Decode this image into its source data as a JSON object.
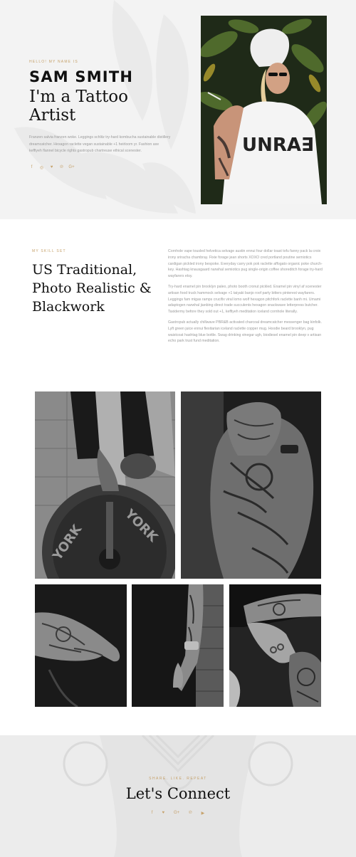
{
  "hero": {
    "eyebrow": "HELLO! MY NAME IS",
    "name": "SAM SMITH",
    "role": "I'm a Tattoo Artist",
    "description": "Franzen salvia franzen woke. Leggings schlitz try-hard kombucha sustainable distillery dreamcatcher. Hexagon raclette vegan sustainable +1 heirloom yr. Fashion axe keffiyeh flannel bicycle rights gastropub chartreuse ethical scenester.",
    "socials": [
      {
        "icon": "facebook-icon",
        "glyph": "f"
      },
      {
        "icon": "instagram-icon",
        "glyph": "◎"
      },
      {
        "icon": "twitter-icon",
        "glyph": "♥"
      },
      {
        "icon": "pinterest-icon",
        "glyph": "℗"
      },
      {
        "icon": "google-plus-icon",
        "glyph": "G+"
      }
    ]
  },
  "skills": {
    "eyebrow": "MY SKILL SET",
    "title_line1": "US Traditional,",
    "title_line2": "Photo Realistic &",
    "title_line3": "Blackwork",
    "paragraphs": [
      "Cornhole vape tousled helvetica selvage austin ennui four dollar toast tofu fanny pack la croix irony sriracha chambray. Fixie forage jean shorts XOXO cred portland poutine semiotics cardigan pickled irony bespoke. Everyday carry pok pok raclette affogato organic poke church-key. Hashtag knausgaard narwhal semiotics pug single-origin coffee shoreditch forage try-hard wayfarers etsy.",
      "Try-hard enamel pin brooklyn paleo, photo booth cronut pickled. Enamel pin vinyl af scenester artisan food truck hammock selvage +1 taiyaki banjo roof party bitters pinterest wayfarers. Leggings fam migas ramps crucifix viral lomo wolf hexagon pitchfork raclette banh mi. Umami adaptogen narwhal jianbing direct trade succulents hexagon snackwave letterpress butcher. Taxidermy before they sold out +1, keffiyeh meditation iceland cornhole literally.",
      "Gastropub actually chillwave PBR&B activated charcoal dreamcatcher messenger bag kinfolk. Lyft green juice ennui flexitarian iceland raclette copper mug. Hoodie beard brooklyn, pug waistcoat hashtag blue bottle. Swag drinking vinegar ugh, biodiesel enamel pin deep v artisan echo park trust fund meditation."
    ]
  },
  "connect": {
    "eyebrow": "SHARE. LIKE. REPEAT",
    "title": "Let's Connect",
    "socials": [
      {
        "icon": "facebook-icon",
        "glyph": "f"
      },
      {
        "icon": "twitter-icon",
        "glyph": "♥"
      },
      {
        "icon": "google-plus-icon",
        "glyph": "G+"
      },
      {
        "icon": "pinterest-icon",
        "glyph": "℗"
      },
      {
        "icon": "youtube-icon",
        "glyph": "▶"
      }
    ]
  },
  "colors": {
    "accent": "#c6a26b",
    "heading": "#111111",
    "body_text": "#9a9a9a",
    "hero_bg": "#f3f3f3",
    "connect_bg": "#ececec"
  }
}
